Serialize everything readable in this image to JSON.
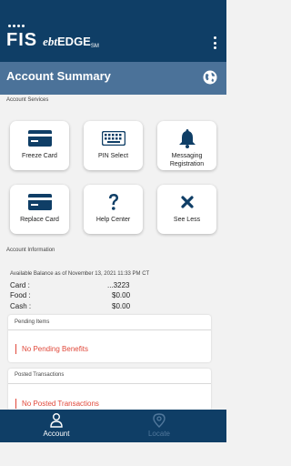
{
  "header": {
    "brand_fis": "FIS",
    "brand_ebt": "ebt",
    "brand_edge": "EDGE",
    "brand_sm": "SM"
  },
  "summary": {
    "title": "Account Summary",
    "globe_icon": "globe-icon"
  },
  "services": {
    "section_label": "Account Services",
    "items": [
      {
        "label": "Freeze Card",
        "icon": "credit-card-icon"
      },
      {
        "label": "PIN Select",
        "icon": "keyboard-icon"
      },
      {
        "label": "Messaging Registration",
        "icon": "bell-icon"
      },
      {
        "label": "Replace Card",
        "icon": "credit-card-icon"
      },
      {
        "label": "Help Center",
        "icon": "question-icon"
      },
      {
        "label": "See Less",
        "icon": "close-icon"
      }
    ]
  },
  "account_info": {
    "section_label": "Account Information",
    "balance_header": "Available Balance as of November 13, 2021 11:33 PM CT",
    "rows": [
      {
        "key": "Card :",
        "value": "...3223"
      },
      {
        "key": "Food :",
        "value": "$0.00"
      },
      {
        "key": "Cash :",
        "value": "$0.00"
      }
    ]
  },
  "pending": {
    "title": "Pending Items",
    "message": "No Pending Benefits"
  },
  "posted": {
    "title": "Posted Transactions",
    "message": "No Posted Transactions"
  },
  "bottom_nav": {
    "account_label": "Account",
    "locate_label": "Locate"
  },
  "colors": {
    "header": "#0f3e66",
    "summary_bar": "#4b7299",
    "alert": "#e0483a"
  }
}
